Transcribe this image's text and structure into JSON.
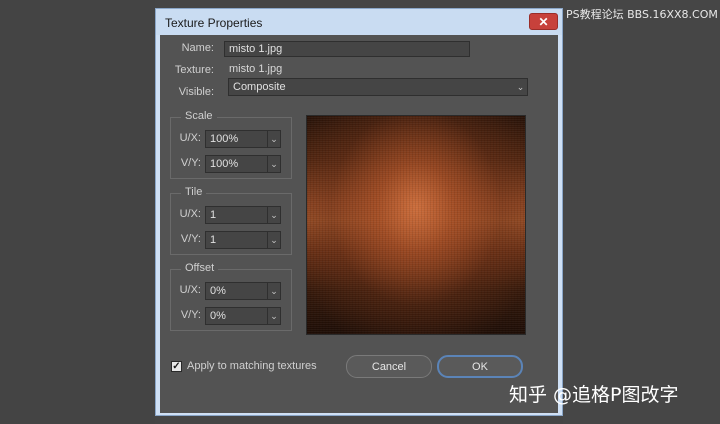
{
  "dialog": {
    "title": "Texture Properties",
    "close_glyph": "✕"
  },
  "fields": {
    "name_label": "Name:",
    "name_value": "misto 1.jpg",
    "texture_label": "Texture:",
    "texture_value": "misto 1.jpg",
    "visible_label": "Visible:",
    "visible_value": "Composite"
  },
  "scale": {
    "title": "Scale",
    "ux_label": "U/X:",
    "ux_value": "100%",
    "vy_label": "V/Y:",
    "vy_value": "100%"
  },
  "tile": {
    "title": "Tile",
    "ux_label": "U/X:",
    "ux_value": "1",
    "vy_label": "V/Y:",
    "vy_value": "1"
  },
  "offset": {
    "title": "Offset",
    "ux_label": "U/X:",
    "ux_value": "0%",
    "vy_label": "V/Y:",
    "vy_value": "0%"
  },
  "apply_checkbox": {
    "label": "Apply to matching textures",
    "checked": true,
    "glyph": "✓"
  },
  "buttons": {
    "cancel": "Cancel",
    "ok": "OK"
  },
  "dropdown_icon": "chevron-down-icon",
  "dropdown_glyph": "⌄",
  "watermarks": {
    "top": "PS教程论坛 BBS.16XX8.COM",
    "bottom": "知乎 @追格P图改字"
  },
  "colors": {
    "background": "#454545",
    "dialog_frame": "#cfe0f5",
    "client": "#535353",
    "close": "#c7413b",
    "ok_border": "#5b84b8"
  }
}
